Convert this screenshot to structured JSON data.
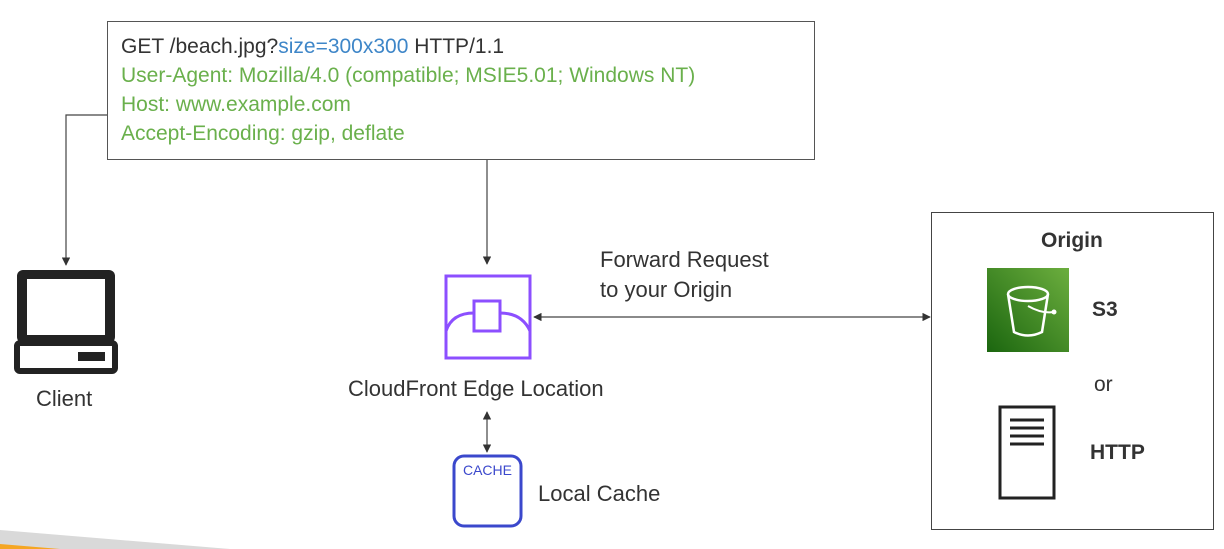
{
  "request": {
    "method_path": "GET /beach.jpg?",
    "query": "size=300x300",
    "protocol": " HTTP/1.1",
    "headers": [
      "User-Agent: Mozilla/4.0 (compatible; MSIE5.01; Windows NT)",
      "Host: www.example.com",
      "Accept-Encoding: gzip, deflate"
    ]
  },
  "client": {
    "label": "Client",
    "icon": "laptop-client-icon"
  },
  "edge": {
    "label": "CloudFront Edge Location",
    "icon": "cloudfront-edge-icon"
  },
  "cache": {
    "icon_text": "CACHE",
    "label": "Local Cache"
  },
  "forward": {
    "line1": "Forward Request",
    "line2": "to your Origin"
  },
  "origin": {
    "title": "Origin",
    "s3_label": "S3",
    "or_label": "or",
    "http_label": "HTTP"
  },
  "colors": {
    "green_text": "#6ab04c",
    "blue_text": "#3e86c8",
    "cloudfront_purple": "#8c4fff",
    "cache_blue": "#3b48cc",
    "s3_green": "#3f8624",
    "accent_orange": "#f5a623"
  }
}
